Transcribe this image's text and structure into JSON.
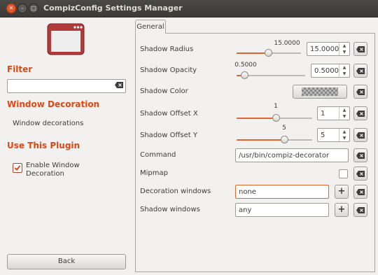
{
  "window": {
    "title": "CompizConfig Settings Manager"
  },
  "sidebar": {
    "filter_heading": "Filter",
    "filter_placeholder": "",
    "window_decoration_heading": "Window Decoration",
    "window_decorations_item": "Window decorations",
    "use_plugin_heading": "Use This Plugin",
    "enable_label": "Enable Window Decoration",
    "enable_checked": true,
    "back_label": "Back"
  },
  "tabs": {
    "general": "General"
  },
  "settings": {
    "shadow_radius": {
      "label": "Shadow Radius",
      "slider_value": "15.0000",
      "spin_value": "15.0000",
      "fraction": 0.5
    },
    "shadow_opacity": {
      "label": "Shadow Opacity",
      "slider_value": "0.5000",
      "spin_value": "0.5000",
      "fraction": 0.1
    },
    "shadow_color": {
      "label": "Shadow Color"
    },
    "shadow_offset_x": {
      "label": "Shadow Offset X",
      "slider_value": "1",
      "spin_value": "1",
      "fraction": 0.5
    },
    "shadow_offset_y": {
      "label": "Shadow Offset Y",
      "slider_value": "5",
      "spin_value": "5",
      "fraction": 0.62
    },
    "command": {
      "label": "Command",
      "value": "/usr/bin/compiz-decorator"
    },
    "mipmap": {
      "label": "Mipmap",
      "checked": false
    },
    "decoration_windows": {
      "label": "Decoration windows",
      "value": "none"
    },
    "shadow_windows": {
      "label": "Shadow windows",
      "value": "any"
    }
  },
  "colors": {
    "accent": "#dd4814",
    "slider_fill": "#e0662c"
  }
}
